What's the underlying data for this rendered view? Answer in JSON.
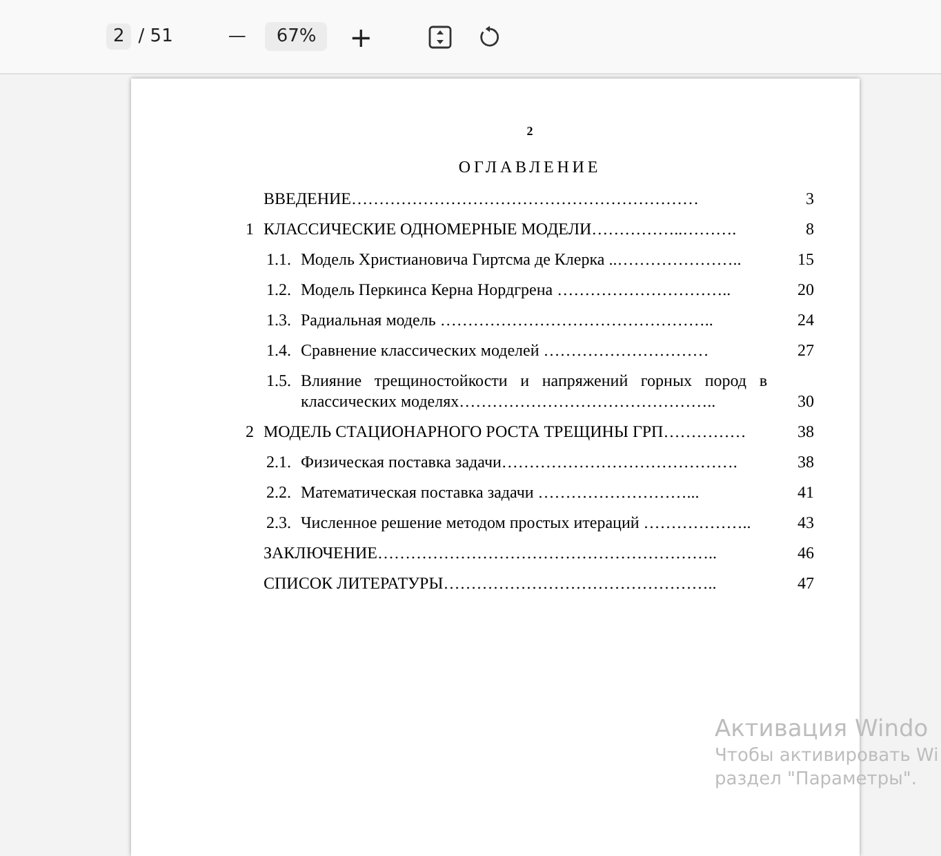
{
  "toolbar": {
    "page_input": "2",
    "page_total": "/ 51",
    "zoom_out": "—",
    "zoom_level": "67%",
    "zoom_in": "+"
  },
  "document_page": {
    "page_number": "2",
    "heading": "ОГЛАВЛЕНИЕ",
    "entries": [
      {
        "kind": "plain",
        "title": "ВВЕДЕНИЕ………………………………………………………",
        "page": "3"
      },
      {
        "kind": "chapter",
        "number": "1",
        "title": "КЛАССИЧЕСКИЕ ОДНОМЕРНЫЕ МОДЕЛИ……………..……….",
        "page": "8"
      },
      {
        "kind": "section",
        "number": "1.1.",
        "title": "Модель Христиановича Гиртсма де Клерка ..…………………..",
        "page": "15"
      },
      {
        "kind": "section",
        "number": "1.2.",
        "title": "Модель Перкинса Керна Нордгрена …………………………..",
        "page": "20"
      },
      {
        "kind": "section",
        "number": "1.3.",
        "title": "Радиальная модель …………………………………………..",
        "page": "24"
      },
      {
        "kind": "section",
        "number": "1.4.",
        "title": "Сравнение классических моделей …………………………",
        "page": "27"
      },
      {
        "kind": "section",
        "number": "1.5.",
        "title": "Влияние трещиностойкости и напряжений горных пород в классических моделях………………………………………..",
        "page": "30"
      },
      {
        "kind": "chapter",
        "number": "2",
        "title": "МОДЕЛЬ СТАЦИОНАРНОГО РОСТА ТРЕЩИНЫ ГРП……………",
        "page": "38"
      },
      {
        "kind": "section",
        "number": "2.1.",
        "title": "Физическая поставка задачи…………………………………….",
        "page": "38"
      },
      {
        "kind": "section",
        "number": "2.2.",
        "title": "Математическая поставка задачи ………………………...",
        "page": "41"
      },
      {
        "kind": "section",
        "number": "2.3.",
        "title": "Численное решение методом простых итераций ………………..",
        "page": "43"
      },
      {
        "kind": "plain",
        "title": "ЗАКЛЮЧЕНИЕ……………………………………………………..",
        "page": "46"
      },
      {
        "kind": "plain",
        "title": "СПИСОК ЛИТЕРАТУРЫ…………………………………………..",
        "page": "47"
      }
    ]
  },
  "activation_notice": {
    "title": "Активация Windo",
    "line_1": "Чтобы активировать Wi",
    "line_2": "раздел \"Параметры\"."
  }
}
